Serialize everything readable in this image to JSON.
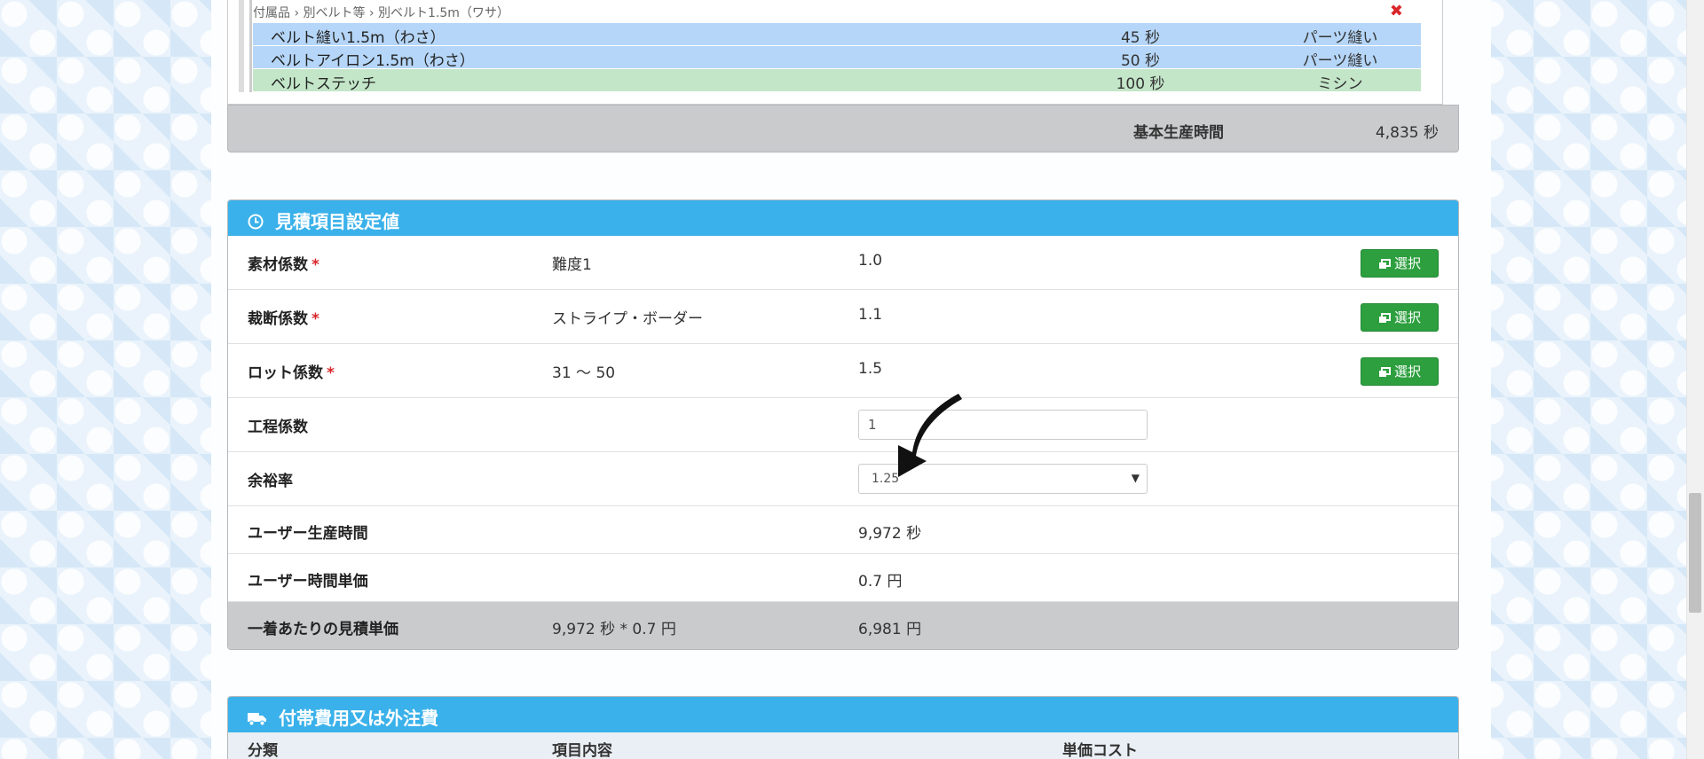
{
  "process_list": {
    "breadcrumb": "付属品 › 別ベルト等 › 別ベルト1.5m（ワサ）",
    "close_glyph": "✖",
    "rows": [
      {
        "name": "ベルト縫い1.5m（わさ）",
        "seconds": "45 秒",
        "type": "パーツ縫い"
      },
      {
        "name": "ベルトアイロン1.5m（わさ）",
        "seconds": "50 秒",
        "type": "パーツ縫い"
      },
      {
        "name": "ベルトステッチ",
        "seconds": "100 秒",
        "type": "ミシン"
      }
    ],
    "total_label": "基本生産時間",
    "total_value": "4,835 秒"
  },
  "estimate_panel": {
    "title": "見積項目設定値",
    "select_label": "選択",
    "required_mark": "*",
    "material": {
      "label": "素材係数",
      "option": "難度1",
      "value": "1.0"
    },
    "cutting": {
      "label": "裁断係数",
      "option": "ストライプ・ボーダー",
      "value": "1.1"
    },
    "lot": {
      "label": "ロット係数",
      "option": "31 ～ 50",
      "value": "1.5"
    },
    "process": {
      "label": "工程係数",
      "input_value": "1"
    },
    "allowance": {
      "label": "余裕率",
      "selected": "1.25"
    },
    "user_time": {
      "label": "ユーザー生産時間",
      "value": "9,972 秒"
    },
    "user_rate": {
      "label": "ユーザー時間単価",
      "value": "0.7 円"
    },
    "unit_price": {
      "label": "一着あたりの見積単価",
      "formula": "9,972 秒 * 0.7 円",
      "value": "6,981 円"
    }
  },
  "extra_panel": {
    "title": "付帯費用又は外注費",
    "columns": [
      "分類",
      "項目内容",
      "単価コスト"
    ]
  },
  "colors": {
    "panel_header": "#3ab1ea",
    "select_button": "#2d9f3f",
    "required": "#d9262a",
    "row_blue": "#b5d6f8",
    "row_green": "#c3e6c8"
  }
}
